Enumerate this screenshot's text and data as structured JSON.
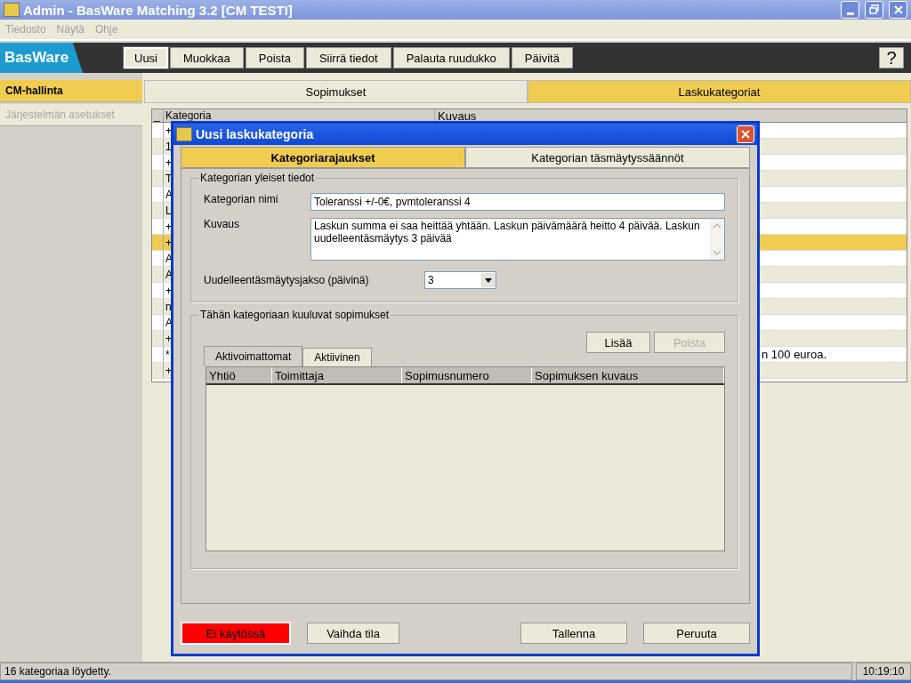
{
  "window": {
    "title": "Admin - BasWare Matching 3.2 [CM TESTI]"
  },
  "menu": [
    {
      "label": "Tiedosto",
      "disabled": true
    },
    {
      "label": "Näytä",
      "disabled": true
    },
    {
      "label": "Ohje",
      "disabled": true
    }
  ],
  "logo": "BasWare",
  "toolbar": [
    {
      "label": "Uusi",
      "pressed": true
    },
    {
      "label": "Muokkaa",
      "pressed": false
    },
    {
      "label": "Poista",
      "pressed": false
    },
    {
      "label": "Siirrä tiedot",
      "pressed": false
    },
    {
      "label": "Palauta ruudukko",
      "pressed": false
    },
    {
      "label": "Päivitä",
      "pressed": false
    }
  ],
  "help": "?",
  "sidebar": {
    "items": [
      {
        "label": "CM-hallinta",
        "selected": true,
        "disabled": false
      },
      {
        "label": "Järjestelmän asetukset",
        "selected": false,
        "disabled": true
      }
    ]
  },
  "tabs": [
    {
      "label": "Sopimukset",
      "selected": false
    },
    {
      "label": "Laskukategoriat",
      "selected": true
    }
  ],
  "table": {
    "columns": [
      "_",
      "Kategoria",
      "Kuvaus"
    ],
    "rows": [
      {
        "kategoria": "+",
        "selected": false
      },
      {
        "kategoria": "1",
        "selected": false
      },
      {
        "kategoria": "+",
        "selected": false
      },
      {
        "kategoria": "T",
        "selected": false
      },
      {
        "kategoria": "A",
        "selected": false
      },
      {
        "kategoria": "L",
        "selected": false
      },
      {
        "kategoria": "+",
        "selected": false
      },
      {
        "kategoria": "+",
        "selected": true
      },
      {
        "kategoria": "A",
        "selected": false
      },
      {
        "kategoria": "A",
        "selected": false
      },
      {
        "kategoria": "+",
        "selected": false
      },
      {
        "kategoria": "n",
        "selected": false
      },
      {
        "kategoria": "A",
        "selected": false
      },
      {
        "kategoria": "+",
        "selected": false
      },
      {
        "kategoria": "*",
        "kuvaus": "n 100 euroa.",
        "selected": false
      },
      {
        "kategoria": "+",
        "selected": false
      }
    ]
  },
  "dialog": {
    "title": "Uusi laskukategoria",
    "tabs": [
      {
        "label": "Kategoriarajaukset",
        "selected": true
      },
      {
        "label": "Kategorian täsmäytyssäännöt",
        "selected": false
      }
    ],
    "general": {
      "legend": "Kategorian yleiset tiedot",
      "name_label": "Kategorian nimi",
      "name_value": "Toleranssi +/-0€, pvmtoleranssi 4",
      "description_label": "Kuvaus",
      "description_value": "Laskun summa ei saa heittää yhtään. Laskun päivämäärä heitto 4 päivää. Laskun uudelleentäsmäytys 3 päivää",
      "period_label": "Uudelleentäsmäytysjakso (päivinä)",
      "period_value": "3"
    },
    "contracts": {
      "legend": "Tähän kategoriaan kuuluvat sopimukset",
      "buttons": [
        {
          "label": "Lisää",
          "disabled": false
        },
        {
          "label": "Poista",
          "disabled": true
        }
      ],
      "tabs": [
        {
          "label": "Aktivoimattomat",
          "selected": true
        },
        {
          "label": "Aktiivinen",
          "selected": false
        }
      ],
      "columns": [
        "Yhtiö",
        "Toimittaja",
        "Sopimusnumero",
        "Sopimuksen kuvaus"
      ]
    },
    "status": {
      "label": "Ei käytössä",
      "color": "#ff0000"
    },
    "buttons": [
      "Vaihda tila",
      "Tallenna",
      "Peruuta"
    ]
  },
  "status_bar": {
    "message": "16 kategoriaa löydetty.",
    "time": "10:19:10"
  }
}
